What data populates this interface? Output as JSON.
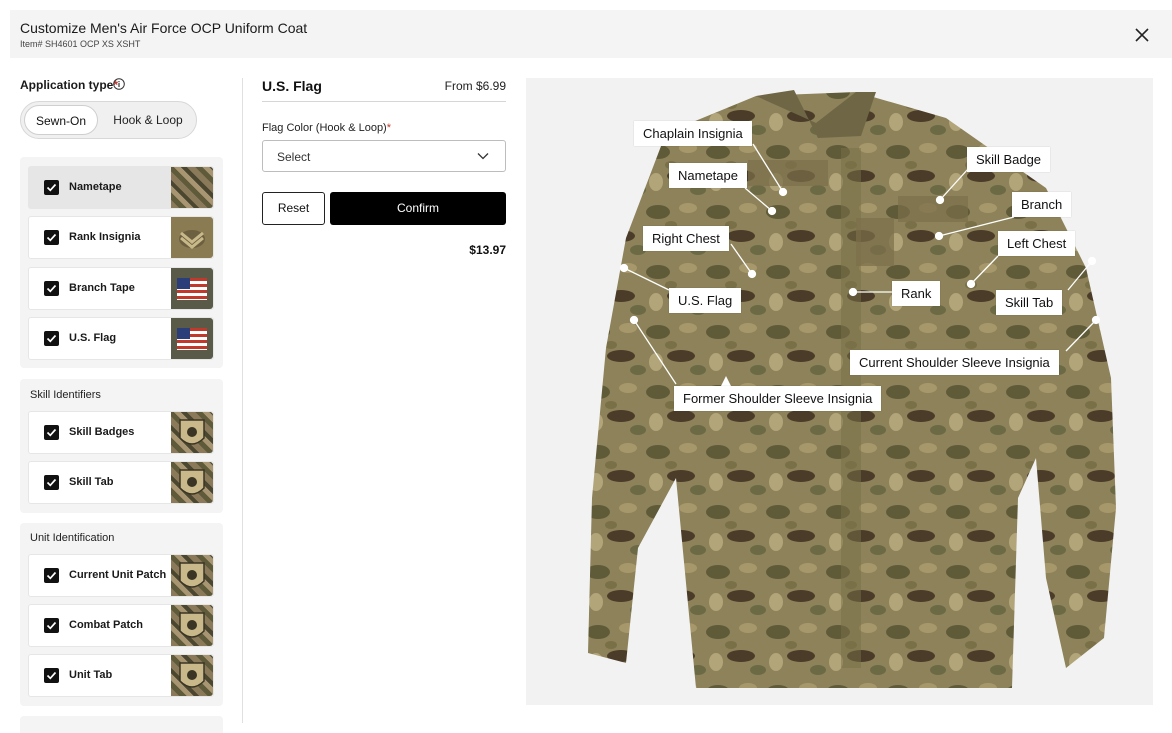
{
  "header": {
    "title": "Customize Men's Air Force OCP Uniform Coat",
    "item": "Item# SH4601 OCP XS XSHT"
  },
  "application_type": {
    "label": "Application type",
    "required_mark": "*",
    "options": [
      "Sewn-On",
      "Hook & Loop"
    ],
    "selected": "Sewn-On"
  },
  "groups": [
    {
      "title": "",
      "items": [
        {
          "label": "Nametape",
          "checked": true
        },
        {
          "label": "Rank Insignia",
          "checked": true
        },
        {
          "label": "Branch Tape",
          "checked": true
        },
        {
          "label": "U.S. Flag",
          "checked": true
        }
      ]
    },
    {
      "title": "Skill Identifiers",
      "items": [
        {
          "label": "Skill Badges",
          "checked": true
        },
        {
          "label": "Skill Tab",
          "checked": true
        }
      ]
    },
    {
      "title": "Unit Identification",
      "items": [
        {
          "label": "Current Unit Patch",
          "checked": true
        },
        {
          "label": "Combat Patch",
          "checked": true
        },
        {
          "label": "Unit Tab",
          "checked": true
        }
      ]
    }
  ],
  "detail": {
    "title": "U.S. Flag",
    "price": "From $6.99",
    "field_label": "Flag Color (Hook & Loop)",
    "required_mark": "*",
    "select_value": "Select",
    "reset_label": "Reset",
    "confirm_label": "Confirm",
    "total": "$13.97"
  },
  "callouts": [
    "Chaplain Insignia",
    "Skill Badge",
    "Nametape",
    "Branch",
    "Right Chest",
    "Left Chest",
    "Rank",
    "U.S. Flag",
    "Skill Tab",
    "Current Shoulder Sleeve Insignia",
    "Former Shoulder Sleeve Insignia"
  ]
}
